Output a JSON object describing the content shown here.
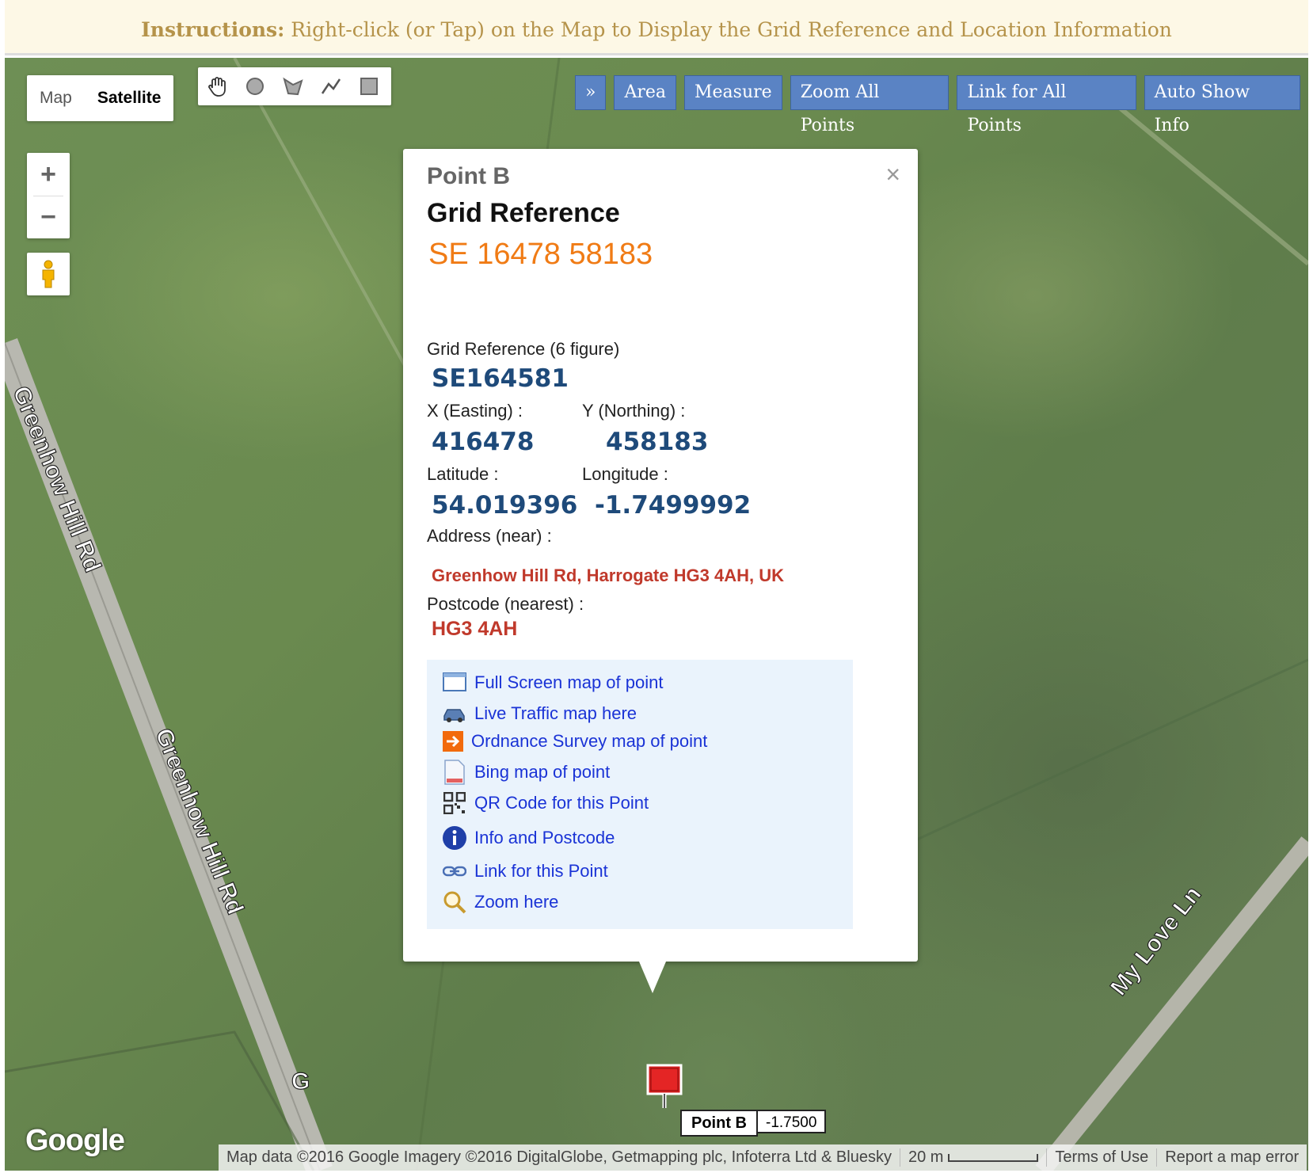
{
  "instructions": {
    "bold": "Instructions:",
    "text": " Right-click (or Tap) on the Map to Display the Grid Reference and Location Information"
  },
  "map_type": {
    "map_label": "Map",
    "satellite_label": "Satellite",
    "selected": "Satellite"
  },
  "draw_tools": [
    "hand-icon",
    "circle-icon",
    "polygon-icon",
    "polyline-icon",
    "rectangle-icon"
  ],
  "top_buttons": [
    {
      "label": "»"
    },
    {
      "label": "Area"
    },
    {
      "label": "Measure"
    },
    {
      "label": "Zoom All Points"
    },
    {
      "label": "Link for All Points"
    },
    {
      "label": "Auto Show Info"
    }
  ],
  "zoom": {
    "in": "+",
    "out": "−"
  },
  "roads": {
    "road1": "Greenhow Hill Rd",
    "road2": "Greenhow Hill Rd",
    "road3": "My Love Ln",
    "road4": "G"
  },
  "popup": {
    "close": "×",
    "title": "Point B",
    "grid_heading": "Grid Reference",
    "grid_value": "SE 16478 58183",
    "six_fig_label": "Grid Reference (6 figure)",
    "six_fig_value": "SE164581",
    "easting_label": "X (Easting) :",
    "northing_label": "Y (Northing) :",
    "easting": "416478",
    "northing": "458183",
    "lat_label": "Latitude :",
    "lon_label": "Longitude :",
    "latitude": "54.019396",
    "longitude": "-1.7499992",
    "address_label": "Address (near) :",
    "address": "Greenhow Hill Rd, Harrogate HG3 4AH, UK",
    "postcode_label": "Postcode (nearest) :",
    "postcode": "HG3 4AH",
    "links": [
      {
        "icon": "fullscreen-icon",
        "label": "Full Screen map of point"
      },
      {
        "icon": "car-icon",
        "label": "Live Traffic map here"
      },
      {
        "icon": "arrow-icon",
        "label": "Ordnance Survey map of point"
      },
      {
        "icon": "document-icon",
        "label": "Bing map of point"
      },
      {
        "icon": "qr-code-icon",
        "label": "QR Code for this Point"
      },
      {
        "icon": "info-icon",
        "label": "Info and Postcode"
      },
      {
        "icon": "chain-link-icon",
        "label": "Link for this Point"
      },
      {
        "icon": "magnifier-icon",
        "label": "Zoom here"
      }
    ]
  },
  "marker": {
    "name": "Point B",
    "value": "-1.7500"
  },
  "google_logo": "Google",
  "attribution": {
    "data": "Map data ©2016 Google Imagery ©2016 DigitalGlobe, Getmapping plc, Infoterra Ltd & Bluesky",
    "scale": "20 m",
    "terms": "Terms of Use",
    "report": "Report a map error"
  },
  "colors": {
    "accent_blue": "#5a83c4",
    "grid_orange": "#f07b15",
    "value_blue": "#1e4a7a",
    "address_red": "#c0392b",
    "link_blue": "#1a33d6"
  }
}
